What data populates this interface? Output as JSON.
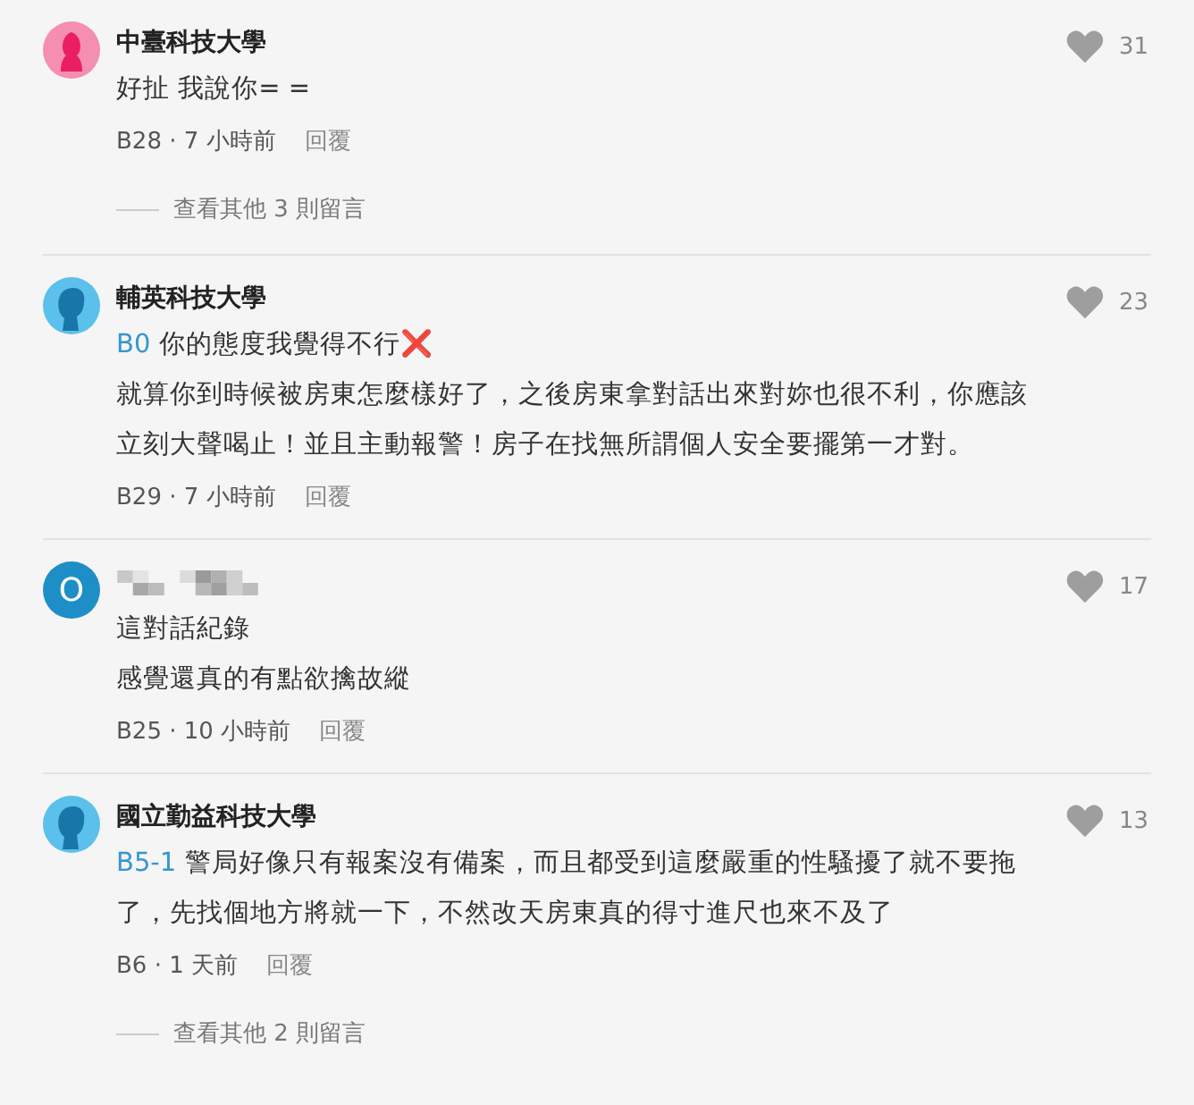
{
  "comments": [
    {
      "avatar": {
        "kind": "female"
      },
      "author": {
        "kind": "name",
        "text": "中臺科技大學"
      },
      "likes": "31",
      "paragraphs": [
        {
          "text": "好扯 我說你= ="
        }
      ],
      "meta": "B28 · 7 小時前",
      "reply": "回覆",
      "more": "查看其他 3 則留言"
    },
    {
      "avatar": {
        "kind": "male"
      },
      "author": {
        "kind": "name",
        "text": "輔英科技大學"
      },
      "likes": "23",
      "paragraphs": [
        {
          "reply_to": "B0",
          "text": "你的態度我覺得不行❌"
        },
        {
          "text": "就算你到時候被房東怎麼樣好了，之後房東拿對話出來對妳也很不利，你應該立刻大聲喝止！並且主動報警！房子在找無所謂個人安全要擺第一才對。"
        }
      ],
      "meta": "B29 · 7 小時前",
      "reply": "回覆"
    },
    {
      "avatar": {
        "kind": "letter",
        "text": "O"
      },
      "author": {
        "kind": "redacted"
      },
      "likes": "17",
      "paragraphs": [
        {
          "text": "這對話紀錄"
        },
        {
          "text": "感覺還真的有點欲擒故縱"
        }
      ],
      "meta": "B25 · 10 小時前",
      "reply": "回覆"
    },
    {
      "avatar": {
        "kind": "male"
      },
      "author": {
        "kind": "name",
        "text": "國立勤益科技大學"
      },
      "likes": "13",
      "paragraphs": [
        {
          "reply_to": "B5-1",
          "text": "警局好像只有報案沒有備案，而且都受到這麼嚴重的性騷擾了就不要拖了，先找個地方將就一下，不然改天房東真的得寸進尺也來不及了"
        }
      ],
      "meta": "B6 · 1 天前",
      "reply": "回覆",
      "more": "查看其他 2 則留言"
    }
  ]
}
